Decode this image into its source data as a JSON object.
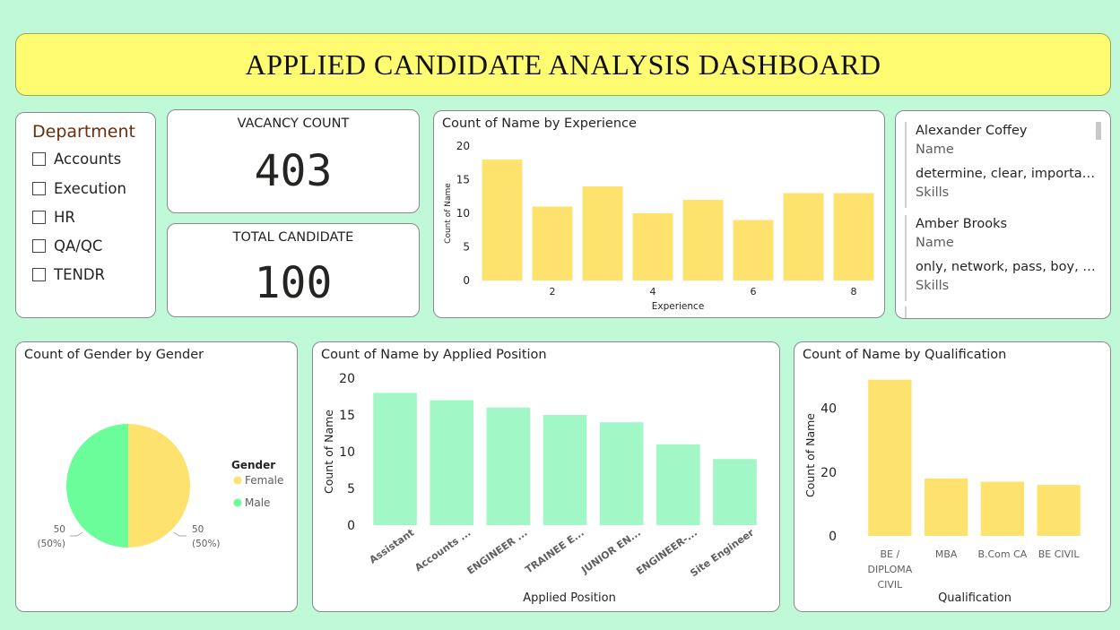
{
  "title": "APPLIED CANDIDATE ANALYSIS DASHBOARD",
  "slicer": {
    "title": "Department",
    "items": [
      "Accounts",
      "Execution",
      "HR",
      "QA/QC",
      "TENDR"
    ]
  },
  "kpis": {
    "vacancy_label": "VACANCY COUNT",
    "vacancy_value": "403",
    "candidate_label": "TOTAL CANDIDATE",
    "candidate_value": "100"
  },
  "candidate_list": {
    "items": [
      {
        "name": "Alexander Coffey",
        "name_label": "Name",
        "skills": "determine, clear, important, ...",
        "skills_label": "Skills"
      },
      {
        "name": "Amber Brooks",
        "name_label": "Name",
        "skills": "only, network, pass, boy, Mrs",
        "skills_label": "Skills"
      }
    ]
  },
  "colors": {
    "yellow_bar": "#fee26e",
    "green_bar": "#a2f7c6",
    "pie_female": "#fee26e",
    "pie_male": "#6cfd9b",
    "banner": "#fffc71",
    "background": "#bff9d7"
  },
  "chart_data": [
    {
      "id": "experience",
      "type": "bar",
      "title": "Count of Name by Experience",
      "xlabel": "Experience",
      "ylabel": "Count of Name",
      "x": [
        1,
        2,
        3,
        4,
        5,
        6,
        7,
        8
      ],
      "values": [
        18,
        11,
        14,
        10,
        12,
        9,
        13,
        13
      ],
      "xticks": [
        "2",
        "4",
        "6",
        "8"
      ],
      "yticks": [
        0,
        5,
        10,
        15,
        20
      ],
      "ylim": [
        0,
        20
      ],
      "grid": false
    },
    {
      "id": "gender",
      "type": "pie",
      "title": "Count of Gender by Gender",
      "legend_title": "Gender",
      "legend_position": "right",
      "categories": [
        "Female",
        "Male"
      ],
      "values": [
        50,
        50
      ],
      "labels": [
        "50\n(50%)",
        "50\n(50%)"
      ]
    },
    {
      "id": "position",
      "type": "bar",
      "title": "Count of Name by Applied Position",
      "xlabel": "Applied Position",
      "ylabel": "Count of Name",
      "categories": [
        "Assistant",
        "Accounts ...",
        "ENGINEER ...",
        "TRAINEE E...",
        "JUNIOR EN...",
        "ENGINEER-...",
        "Site Engineer"
      ],
      "values": [
        18,
        17,
        16,
        15,
        14,
        11,
        9
      ],
      "yticks": [
        0,
        5,
        10,
        15,
        20
      ],
      "ylim": [
        0,
        20
      ],
      "grid": false
    },
    {
      "id": "qualification",
      "type": "bar",
      "title": "Count of Name by Qualification",
      "xlabel": "Qualification",
      "ylabel": "Count of Name",
      "categories": [
        "BE / DIPLOMA CIVIL",
        "MBA",
        "B.Com CA",
        "BE CIVIL"
      ],
      "category_lines": [
        [
          "BE /",
          "DIPLOMA",
          "CIVIL"
        ],
        [
          "MBA"
        ],
        [
          "B.Com CA"
        ],
        [
          "BE CIVIL"
        ]
      ],
      "values": [
        49,
        18,
        17,
        16
      ],
      "yticks": [
        0,
        20,
        40
      ],
      "ylim": [
        0,
        52
      ],
      "grid": false
    }
  ]
}
